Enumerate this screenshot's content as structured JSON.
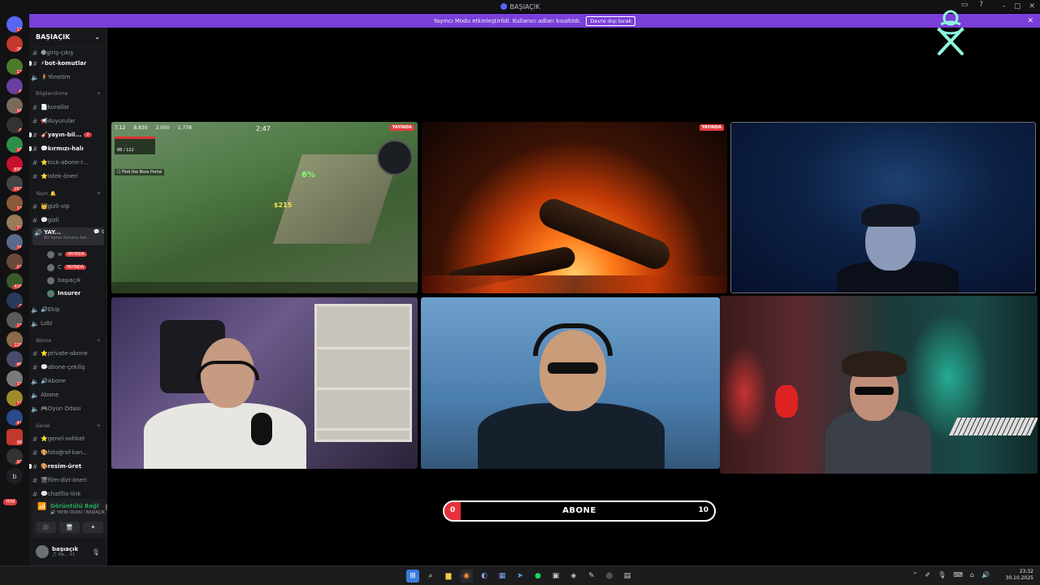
{
  "window": {
    "title": "BAŞIAÇIK"
  },
  "banner": {
    "message": "Yayıncı Modu etkinleştirildi. Kullanıcı adları kısaltıldı.",
    "button_label": "Devre dışı bırak",
    "close_glyph": "✕"
  },
  "server_rail": {
    "badges": [
      "17",
      "26",
      "13",
      "6",
      "34",
      "5",
      "20",
      "15",
      "830",
      "267",
      "17",
      "72",
      "74",
      "21",
      "418",
      "7",
      "13",
      "128",
      "46",
      "37",
      "71",
      "41",
      "98",
      "10"
    ],
    "new_label": "YENİ",
    "dm_letter": "b"
  },
  "sidebar": {
    "server_name": "BAŞIAÇIK",
    "channels": {
      "giris": "🌑giriş-çıkış",
      "bot": "⚡bot-komutlar",
      "yonetim": "🧍Yönetim",
      "cat_bilgi": "Bilgilendirme",
      "kurallar": "📄kurallar",
      "duyurular": "📢duyurular",
      "yayin_bil": "🎸yayın-bil...",
      "yayin_bil_badge": "2",
      "kirmizi": "💬kırmızı-halı",
      "kick": "⭐kick-abone-r...",
      "istek": "⭐istek-öneri",
      "cat_yayin": "Yayın 🔔",
      "gizli_vip": "👑gizli-vip",
      "gizli": "💬gizli",
      "yayin_voice": "YAY...",
      "yayin_voice_sub": "Bir kanal durumu bel...",
      "user1": "w",
      "user1_badge": "YAYINDA",
      "user2": "C",
      "user2_badge": "YAYINDA",
      "user3": "başıaçık",
      "user4": "Insurer",
      "ekip": "🔊Ekip",
      "lobi": "Lobi",
      "cat_abone": "Abone",
      "private_abone": "⭐private-abone",
      "abone_cekilis": "💬abone-çekiliş",
      "abone_v1": "🔊Abone",
      "abone_v2": "Abone",
      "oyun": "🎮Oyun Odası",
      "cat_genel": "Genel",
      "genel_sohbet": "⭐genel-sohbet",
      "fotograf": "🎨fotoğraf-kan...",
      "resim": "🎨resim-üret",
      "film": "🎬film-dizi-öneri",
      "chatflix": "💬chatflix-link"
    },
    "voice": {
      "title": "Görüntülü Bağl",
      "subtitle": "🔊 YAYIN ODASI / BAŞIAÇIK"
    },
    "user": {
      "name": "başıaçık",
      "status": "🎵 Ha... +1"
    }
  },
  "stage": {
    "live_label": "YAYINDA",
    "game_hud": {
      "stat1": "7.12",
      "stat2": "8.830",
      "stat3": "2.050",
      "stat4": "1.778",
      "timer": "2:47",
      "quest": "☐ Find the Boss Portal",
      "pct": "6%",
      "gold": "$215",
      "hp": "88 / 122"
    }
  },
  "subgoal": {
    "current": "0",
    "label": "ABONE",
    "target": "10",
    "progress": 0.06
  },
  "taskbar": {
    "time": "23:32",
    "date": "30.10.2025"
  },
  "colors": {
    "accent": "#7a3fd8",
    "live": "#e03c3c",
    "goal_fill": "#e8303a",
    "voice_ok": "#23a55a"
  }
}
